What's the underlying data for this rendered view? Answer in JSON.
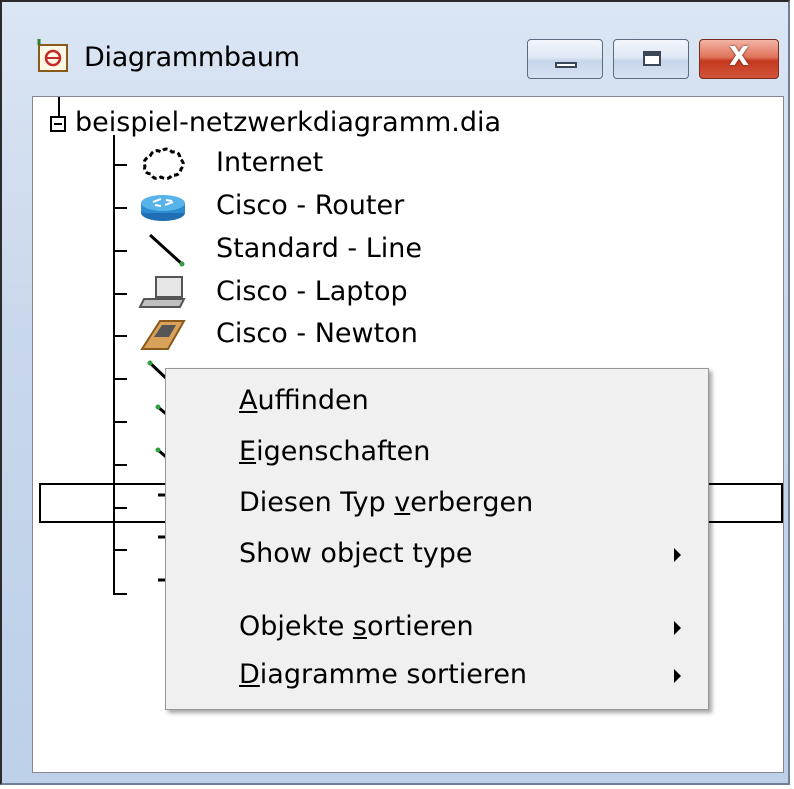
{
  "window": {
    "title": "Diagrammbaum",
    "icon": "dia-diagram-icon",
    "buttons": {
      "minimize": "minimize-icon",
      "maximize": "maximize-icon",
      "close": "X"
    }
  },
  "tree": {
    "root_label": "beispiel-netzwerkdiagramm.dia",
    "items": [
      {
        "label": "Internet",
        "icon": "cloud-icon"
      },
      {
        "label": "Cisco - Router",
        "icon": "router-icon"
      },
      {
        "label": "Standard - Line",
        "icon": "line-icon"
      },
      {
        "label": "Cisco - Laptop",
        "icon": "laptop-icon"
      },
      {
        "label": "Cisco - Newton",
        "icon": "newton-icon"
      }
    ]
  },
  "context_menu": {
    "items": [
      {
        "mnemonic": "A",
        "rest": "uffinden",
        "submenu": false
      },
      {
        "mnemonic": "E",
        "rest": "igenschaften",
        "submenu": false
      },
      {
        "before": "Diesen Typ ",
        "mnemonic": "v",
        "rest": "erbergen",
        "submenu": false
      },
      {
        "label": "Show object type",
        "submenu": true
      },
      {
        "before": "Objekte ",
        "mnemonic": "s",
        "rest": "ortieren",
        "submenu": true
      },
      {
        "mnemonic": "D",
        "rest": "iagramme sortieren",
        "submenu": true
      }
    ]
  }
}
